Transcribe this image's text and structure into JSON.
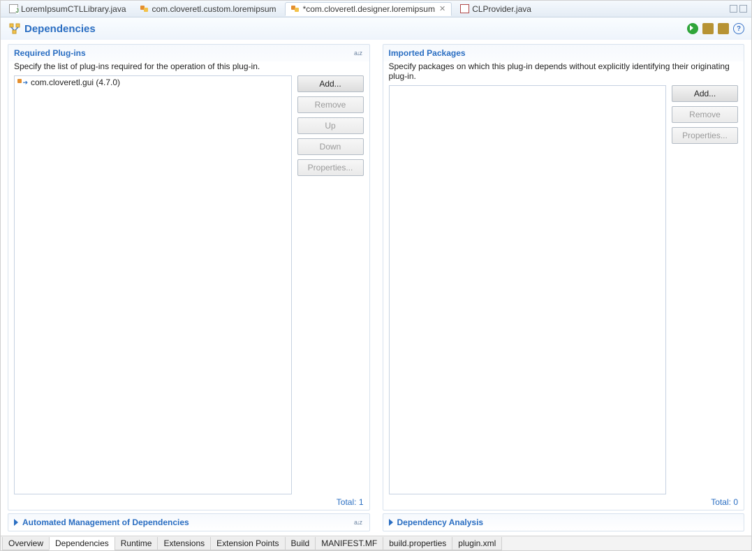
{
  "editorTabs": [
    {
      "label": "LoremIpsumCTLLibrary.java",
      "icon": "java"
    },
    {
      "label": "com.cloveretl.custom.loremipsum",
      "icon": "plug"
    },
    {
      "label": "*com.cloveretl.designer.loremipsum",
      "icon": "plug",
      "active": true,
      "closable": true
    },
    {
      "label": "CLProvider.java",
      "icon": "xml"
    }
  ],
  "header": {
    "title": "Dependencies"
  },
  "required": {
    "title": "Required Plug-ins",
    "desc": "Specify the list of plug-ins required for the operation of this plug-in.",
    "items": [
      {
        "label": "com.cloveretl.gui (4.7.0)"
      }
    ],
    "buttons": {
      "add": "Add...",
      "remove": "Remove",
      "up": "Up",
      "down": "Down",
      "props": "Properties..."
    },
    "total": "Total: 1"
  },
  "imported": {
    "title": "Imported Packages",
    "desc": "Specify packages on which this plug-in depends without explicitly identifying their originating plug-in.",
    "buttons": {
      "add": "Add...",
      "remove": "Remove",
      "props": "Properties..."
    },
    "total": "Total: 0"
  },
  "collapsed": {
    "auto": "Automated Management of Dependencies",
    "analysis": "Dependency Analysis"
  },
  "pageTabs": [
    "Overview",
    "Dependencies",
    "Runtime",
    "Extensions",
    "Extension Points",
    "Build",
    "MANIFEST.MF",
    "build.properties",
    "plugin.xml"
  ],
  "activePageTab": "Dependencies"
}
